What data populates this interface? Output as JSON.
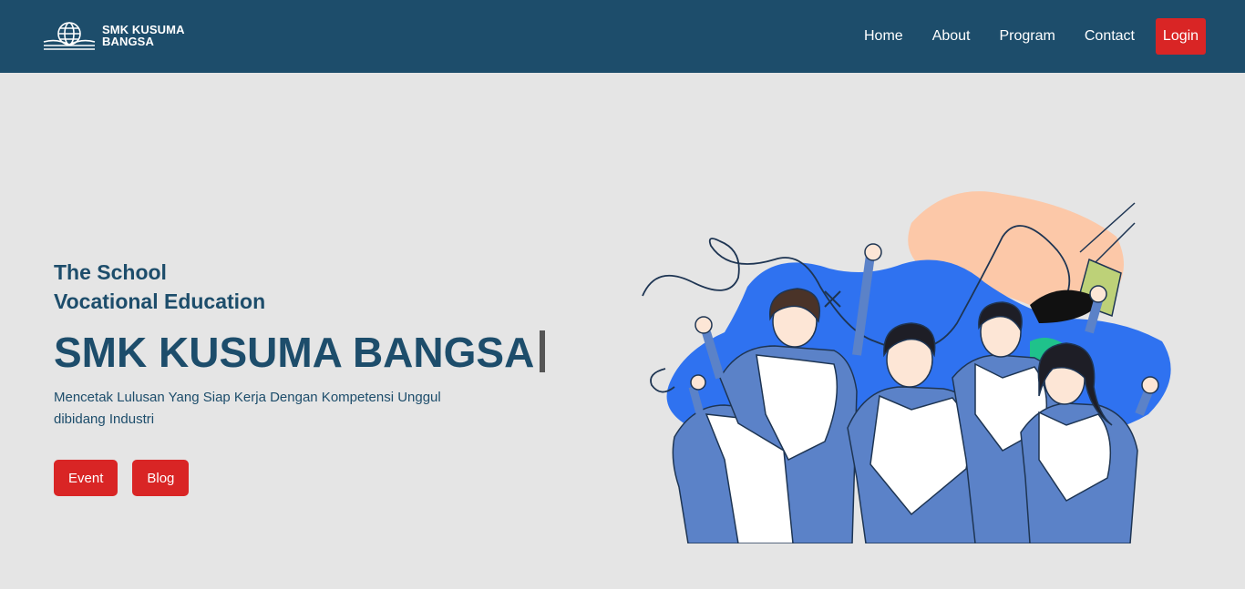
{
  "brand": {
    "line1": "SMK KUSUMA",
    "line2": "BANGSA",
    "logo_icon": "globe-book-icon"
  },
  "nav": {
    "links": [
      "Home",
      "About",
      "Program",
      "Contact"
    ],
    "login_label": "Login"
  },
  "hero": {
    "subtitle_line1": "The School",
    "subtitle_line2": "Vocational Education",
    "title": "SMK KUSUMA BANGSA",
    "tagline": "Mencetak Lulusan Yang Siap Kerja Dengan Kompetensi Unggul dibidang Industri",
    "buttons": [
      "Event",
      "Blog"
    ]
  },
  "colors": {
    "navbar": "#1d4d6b",
    "accent": "#d92525",
    "background": "#e5e5e5",
    "text": "#1d4d6b"
  }
}
